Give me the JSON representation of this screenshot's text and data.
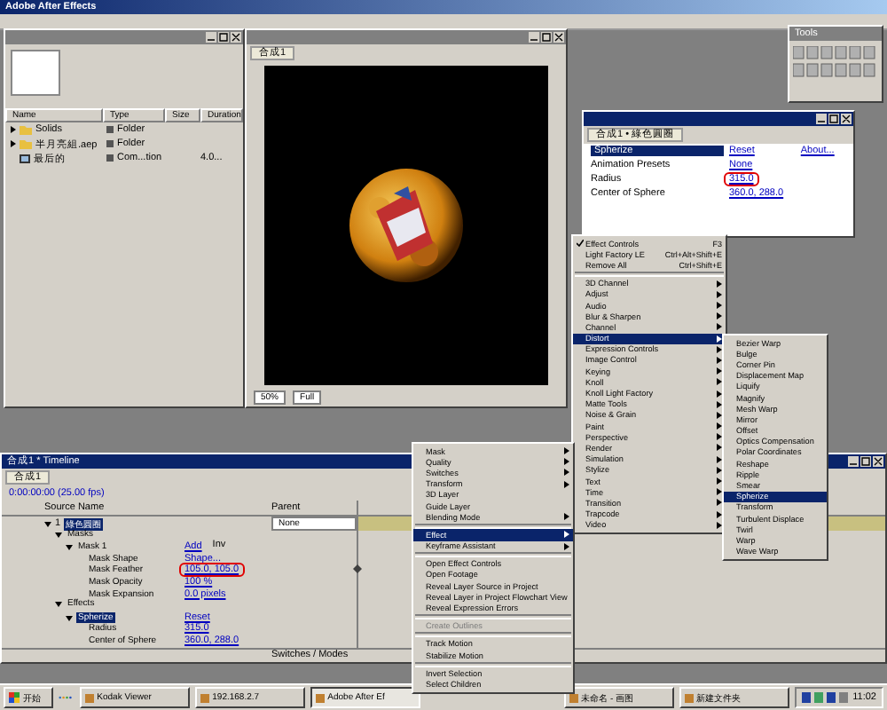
{
  "app_title": "Adobe After Effects",
  "project": {
    "columns": [
      "Name",
      "Type",
      "Size",
      "Duration"
    ],
    "items": [
      {
        "name": "Solids",
        "type": "Folder",
        "kind": "folder",
        "expandable": true
      },
      {
        "name": "半月亮組.aep",
        "type": "Folder",
        "kind": "folder",
        "expandable": true
      },
      {
        "name": "最后的",
        "type": "Com...tion",
        "duration": "4.0...",
        "kind": "comp",
        "expandable": false
      }
    ]
  },
  "composition": {
    "tab": "合成1",
    "zoom": "50%",
    "resolution": "Full"
  },
  "tools": {
    "title": "Tools"
  },
  "effect_controls": {
    "tab": "合成1 • 綠色圓圈",
    "effect": "Spherize",
    "reset": "Reset",
    "about": "About...",
    "rows": [
      {
        "label": "Animation Presets",
        "value": "None",
        "highlighted": false
      },
      {
        "label": "Radius",
        "value": "315.0",
        "highlighted": true
      },
      {
        "label": "Center of Sphere",
        "value": "360.0, 288.0",
        "highlighted": false
      }
    ]
  },
  "effect_menu": [
    {
      "kind": "item",
      "label": "Effect Controls",
      "shortcut": "F3",
      "checked": true,
      "submenu": false,
      "selected": false
    },
    {
      "kind": "item",
      "label": "Light Factory LE",
      "shortcut": "Ctrl+Alt+Shift+E",
      "checked": false,
      "submenu": false,
      "selected": false
    },
    {
      "kind": "item",
      "label": "Remove All",
      "shortcut": "Ctrl+Shift+E",
      "checked": false,
      "submenu": false,
      "selected": false
    },
    {
      "kind": "separator"
    },
    {
      "kind": "item",
      "label": "3D Channel",
      "checked": false,
      "submenu": true,
      "selected": false
    },
    {
      "kind": "item",
      "label": "Adjust",
      "checked": false,
      "submenu": true,
      "selected": false
    },
    {
      "kind": "item",
      "label": "Audio",
      "checked": false,
      "submenu": true,
      "selected": false
    },
    {
      "kind": "item",
      "label": "Blur & Sharpen",
      "checked": false,
      "submenu": true,
      "selected": false
    },
    {
      "kind": "item",
      "label": "Channel",
      "checked": false,
      "submenu": true,
      "selected": false
    },
    {
      "kind": "item",
      "label": "Distort",
      "checked": false,
      "submenu": true,
      "selected": true
    },
    {
      "kind": "item",
      "label": "Expression Controls",
      "checked": false,
      "submenu": true,
      "selected": false
    },
    {
      "kind": "item",
      "label": "Image Control",
      "checked": false,
      "submenu": true,
      "selected": false
    },
    {
      "kind": "item",
      "label": "Keying",
      "checked": false,
      "submenu": true,
      "selected": false
    },
    {
      "kind": "item",
      "label": "Knoll",
      "checked": false,
      "submenu": true,
      "selected": false
    },
    {
      "kind": "item",
      "label": "Knoll Light Factory",
      "checked": false,
      "submenu": true,
      "selected": false
    },
    {
      "kind": "item",
      "label": "Matte Tools",
      "checked": false,
      "submenu": true,
      "selected": false
    },
    {
      "kind": "item",
      "label": "Noise & Grain",
      "checked": false,
      "submenu": true,
      "selected": false
    },
    {
      "kind": "item",
      "label": "Paint",
      "checked": false,
      "submenu": true,
      "selected": false
    },
    {
      "kind": "item",
      "label": "Perspective",
      "checked": false,
      "submenu": true,
      "selected": false
    },
    {
      "kind": "item",
      "label": "Render",
      "checked": false,
      "submenu": true,
      "selected": false
    },
    {
      "kind": "item",
      "label": "Simulation",
      "checked": false,
      "submenu": true,
      "selected": false
    },
    {
      "kind": "item",
      "label": "Stylize",
      "checked": false,
      "submenu": true,
      "selected": false
    },
    {
      "kind": "item",
      "label": "Text",
      "checked": false,
      "submenu": true,
      "selected": false
    },
    {
      "kind": "item",
      "label": "Time",
      "checked": false,
      "submenu": true,
      "selected": false
    },
    {
      "kind": "item",
      "label": "Transition",
      "checked": false,
      "submenu": true,
      "selected": false
    },
    {
      "kind": "item",
      "label": "Trapcode",
      "checked": false,
      "submenu": true,
      "selected": false
    },
    {
      "kind": "item",
      "label": "Video",
      "checked": false,
      "submenu": true,
      "selected": false
    }
  ],
  "distort_menu": [
    {
      "label": "Bezier Warp",
      "selected": false
    },
    {
      "label": "Bulge",
      "selected": false
    },
    {
      "label": "Corner Pin",
      "selected": false
    },
    {
      "label": "Displacement Map",
      "selected": false
    },
    {
      "label": "Liquify",
      "selected": false
    },
    {
      "label": "Magnify",
      "selected": false
    },
    {
      "label": "Mesh Warp",
      "selected": false
    },
    {
      "label": "Mirror",
      "selected": false
    },
    {
      "label": "Offset",
      "selected": false
    },
    {
      "label": "Optics Compensation",
      "selected": false
    },
    {
      "label": "Polar Coordinates",
      "selected": false
    },
    {
      "label": "Reshape",
      "selected": false
    },
    {
      "label": "Ripple",
      "selected": false
    },
    {
      "label": "Smear",
      "selected": false
    },
    {
      "label": "Spherize",
      "selected": true
    },
    {
      "label": "Transform",
      "selected": false
    },
    {
      "label": "Turbulent Displace",
      "selected": false
    },
    {
      "label": "Twirl",
      "selected": false
    },
    {
      "label": "Warp",
      "selected": false
    },
    {
      "label": "Wave Warp",
      "selected": false
    }
  ],
  "context_menu": [
    {
      "kind": "item",
      "label": "Mask",
      "submenu": true,
      "selected": false,
      "disabled": false
    },
    {
      "kind": "item",
      "label": "Quality",
      "submenu": true,
      "selected": false,
      "disabled": false
    },
    {
      "kind": "item",
      "label": "Switches",
      "submenu": true,
      "selected": false,
      "disabled": false
    },
    {
      "kind": "item",
      "label": "Transform",
      "submenu": true,
      "selected": false,
      "disabled": false
    },
    {
      "kind": "item",
      "label": "3D Layer",
      "submenu": false,
      "selected": false,
      "disabled": false
    },
    {
      "kind": "item",
      "label": "Guide Layer",
      "submenu": false,
      "selected": false,
      "disabled": false
    },
    {
      "kind": "item",
      "label": "Blending Mode",
      "submenu": true,
      "selected": false,
      "disabled": false
    },
    {
      "kind": "separator"
    },
    {
      "kind": "item",
      "label": "Effect",
      "submenu": true,
      "selected": true,
      "disabled": false
    },
    {
      "kind": "item",
      "label": "Keyframe Assistant",
      "submenu": true,
      "selected": false,
      "disabled": false
    },
    {
      "kind": "separator"
    },
    {
      "kind": "item",
      "label": "Open Effect Controls",
      "submenu": false,
      "selected": false,
      "disabled": false
    },
    {
      "kind": "item",
      "label": "Open Footage",
      "submenu": false,
      "selected": false,
      "disabled": false
    },
    {
      "kind": "item",
      "label": "Reveal Layer Source in Project",
      "submenu": false,
      "selected": false,
      "disabled": false
    },
    {
      "kind": "item",
      "label": "Reveal Layer in Project Flowchart View",
      "submenu": false,
      "selected": false,
      "disabled": false
    },
    {
      "kind": "item",
      "label": "Reveal Expression Errors",
      "submenu": false,
      "selected": false,
      "disabled": false
    },
    {
      "kind": "separator"
    },
    {
      "kind": "item",
      "label": "Create Outlines",
      "submenu": false,
      "selected": false,
      "disabled": true
    },
    {
      "kind": "separator"
    },
    {
      "kind": "item",
      "label": "Track Motion",
      "submenu": false,
      "selected": false,
      "disabled": false
    },
    {
      "kind": "item",
      "label": "Stabilize Motion",
      "submenu": false,
      "selected": false,
      "disabled": false
    },
    {
      "kind": "separator"
    },
    {
      "kind": "item",
      "label": "Invert Selection",
      "submenu": false,
      "selected": false,
      "disabled": false
    },
    {
      "kind": "item",
      "label": "Select Children",
      "submenu": false,
      "selected": false,
      "disabled": false
    }
  ],
  "timeline": {
    "title": "合成1 * Timeline",
    "tab": "合成1",
    "time": "0:00:00:00 (25.00 fps)",
    "columns": [
      "Source Name",
      "Parent"
    ],
    "footer": "Switches / Modes",
    "layers": [
      {
        "number": "1",
        "name": "綠色圓圈",
        "parent": "None",
        "selected": true,
        "children": [
          {
            "name": "Masks",
            "children": [
              {
                "name": "Mask 1",
                "value": "Add",
                "extra": "Inv",
                "children": [
                  {
                    "name": "Mask Shape",
                    "value": "Shape...",
                    "highlighted": false,
                    "keyframe": false
                  },
                  {
                    "name": "Mask Feather",
                    "value": "105.0, 105.0",
                    "highlighted": true,
                    "keyframe": true
                  },
                  {
                    "name": "Mask Opacity",
                    "value": "100 %",
                    "highlighted": false,
                    "keyframe": false
                  },
                  {
                    "name": "Mask Expansion",
                    "value": "0.0 pixels",
                    "highlighted": false,
                    "keyframe": false
                  }
                ]
              }
            ]
          },
          {
            "name": "Effects",
            "children": [
              {
                "name": "Spherize",
                "value": "Reset",
                "selected": true,
                "children": [
                  {
                    "name": "Radius",
                    "value": "315.0",
                    "highlighted": false,
                    "keyframe": false
                  },
                  {
                    "name": "Center of Sphere",
                    "value": "360.0, 288.0",
                    "highlighted": false,
                    "keyframe": false
                  }
                ]
              }
            ]
          }
        ]
      }
    ]
  },
  "taskbar": {
    "start": "开始",
    "tasks": [
      {
        "label": "Kodak Viewer",
        "selected": false
      },
      {
        "label": "192.168.2.7",
        "selected": false
      },
      {
        "label": "Adobe After Ef",
        "selected": true
      },
      {
        "label": "未命名 - 画图",
        "selected": false
      },
      {
        "label": "新建文件夹",
        "selected": false
      }
    ],
    "clock": "11:02"
  }
}
